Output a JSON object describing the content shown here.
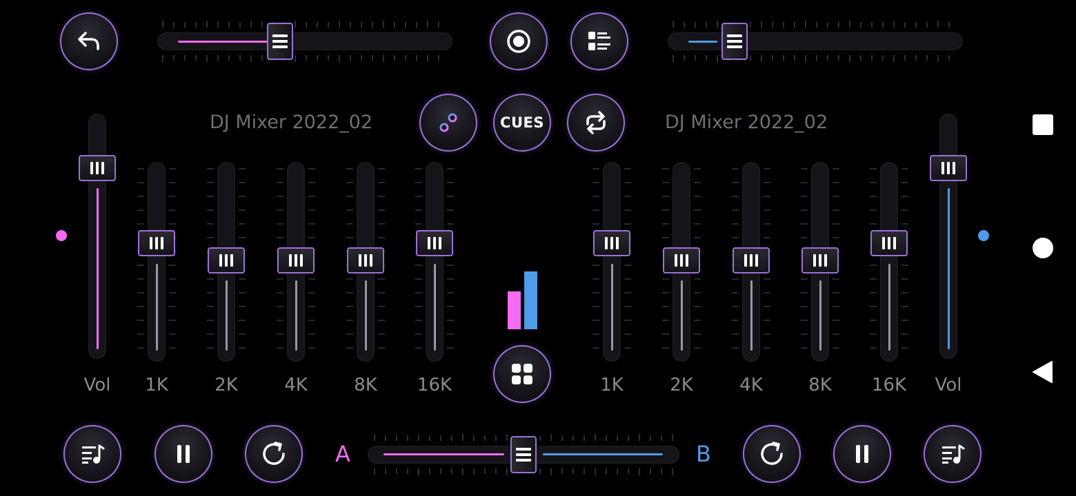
{
  "colors": {
    "deck_a": "#f36cf2",
    "deck_b": "#4f9ce8",
    "accent_border": "#9b72d6",
    "background": "#000000"
  },
  "top_bar": {
    "back_icon": "undo-arrow-icon",
    "record_icon": "record-icon",
    "playlist_icon": "list-view-icon",
    "deck_a_pitch": 0.4,
    "deck_b_pitch": 0.2
  },
  "center_controls": {
    "eq_icon": "sliders-icon",
    "cues_label": "CUES",
    "loop_icon": "loop-arrows-icon",
    "grid_icon": "grid-icon",
    "level_a": 0.65,
    "level_b": 1.0
  },
  "deck_a": {
    "title": "DJ Mixer 2022_02",
    "volume_label": "Vol",
    "volume": 0.9,
    "eq": [
      {
        "label": "1K",
        "value": 0.6
      },
      {
        "label": "2K",
        "value": 0.5
      },
      {
        "label": "4K",
        "value": 0.5
      },
      {
        "label": "8K",
        "value": 0.5
      },
      {
        "label": "16K",
        "value": 0.6
      }
    ]
  },
  "deck_b": {
    "title": "DJ Mixer 2022_02",
    "volume_label": "Vol",
    "volume": 0.9,
    "eq": [
      {
        "label": "1K",
        "value": 0.6
      },
      {
        "label": "2K",
        "value": 0.5
      },
      {
        "label": "4K",
        "value": 0.5
      },
      {
        "label": "8K",
        "value": 0.5
      },
      {
        "label": "16K",
        "value": 0.6
      }
    ]
  },
  "bottom_bar": {
    "crossfader_left_label": "A",
    "crossfader_right_label": "B",
    "crossfader": 0.5,
    "deck_a_buttons": [
      "playlist-music-icon",
      "pause-icon",
      "restart-icon"
    ],
    "deck_b_buttons": [
      "restart-icon",
      "pause-icon",
      "playlist-music-icon"
    ]
  },
  "system_nav": [
    "recents-square-icon",
    "home-circle-icon",
    "back-triangle-icon"
  ]
}
